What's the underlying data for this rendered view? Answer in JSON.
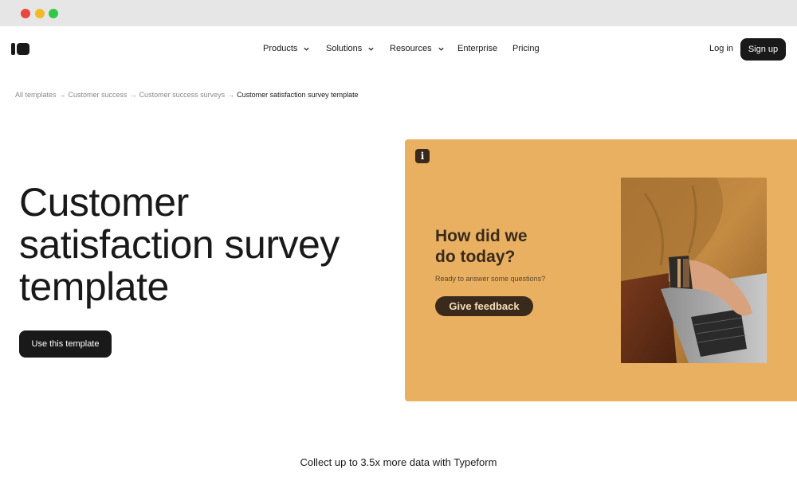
{
  "nav": {
    "items": [
      {
        "label": "Products",
        "has_dropdown": true
      },
      {
        "label": "Solutions",
        "has_dropdown": true
      },
      {
        "label": "Resources",
        "has_dropdown": true
      },
      {
        "label": "Enterprise",
        "has_dropdown": false
      },
      {
        "label": "Pricing",
        "has_dropdown": false
      }
    ],
    "login_label": "Log in",
    "signup_label": "Sign up"
  },
  "breadcrumb": {
    "items": [
      "All templates",
      "Customer success",
      "Customer success surveys"
    ],
    "current": "Customer satisfaction survey template",
    "separator": "→"
  },
  "hero": {
    "title_lines": [
      "Customer",
      "satisfaction survey",
      "template"
    ],
    "cta_label": "Use this template"
  },
  "preview": {
    "info_icon": "i",
    "question_lines": [
      "How did we",
      "do today?"
    ],
    "subtitle": "Ready to answer some questions?",
    "button_label": "Give feedback",
    "background_color": "#e8b060",
    "accent_color": "#3a2a1c"
  },
  "tagline": "Collect up to 3.5x more data with Typeform"
}
